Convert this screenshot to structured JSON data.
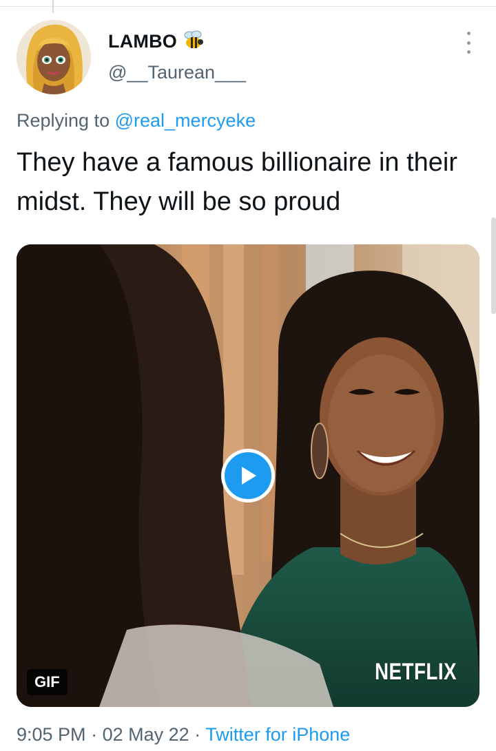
{
  "tweet": {
    "author": {
      "display_name": "LAMBO",
      "emoji_icon": "bee-emoji-icon",
      "handle": "@__Taurean___"
    },
    "reply": {
      "prefix": "Replying to",
      "mention": "@real_mercyeke"
    },
    "text": "They have a famous billionaire in their midst. They will be so proud",
    "media": {
      "badge": "GIF",
      "watermark": "NETFLIX",
      "play_icon": "play-icon"
    },
    "meta": {
      "time": "9:05 PM",
      "separator": "·",
      "date": "02 May 22",
      "source": "Twitter for iPhone"
    }
  },
  "colors": {
    "accent": "#1d9bf0",
    "secondary_text": "#536471",
    "primary_text": "#0f1419"
  }
}
